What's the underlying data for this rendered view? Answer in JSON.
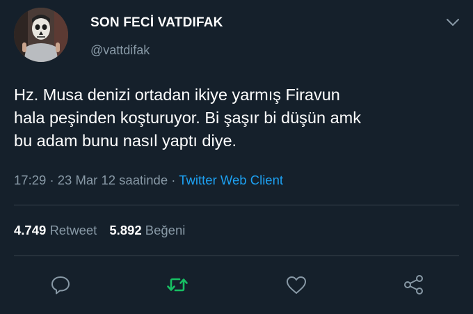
{
  "user": {
    "name": "SON FECİ VATDIFAK",
    "handle": "@vattdifak",
    "avatar_icon": "avatar-skull-mask"
  },
  "tweet": {
    "lines": [
      "Hz. Musa denizi ortadan ikiye yarmış Firavun",
      "hala peşinden koşturuyor. Bi şaşır bi düşün amk",
      "bu adam bunu nasıl yaptı diye."
    ],
    "time": "17:29",
    "date": "23 Mar 12 saatinde",
    "separator": "·",
    "client": "Twitter Web Client"
  },
  "stats": {
    "retweets": "4.749",
    "retweets_label": "Retweet",
    "likes": "5.892",
    "likes_label": "Beğeni"
  },
  "actions": [
    "reply-icon",
    "retweet-icon",
    "like-icon",
    "share-icon"
  ],
  "colors": {
    "background": "#15202b",
    "text": "#ffffff",
    "secondary": "#8899a6",
    "link": "#1da1f2",
    "retweet": "#17bf63",
    "divider": "#38444d"
  }
}
